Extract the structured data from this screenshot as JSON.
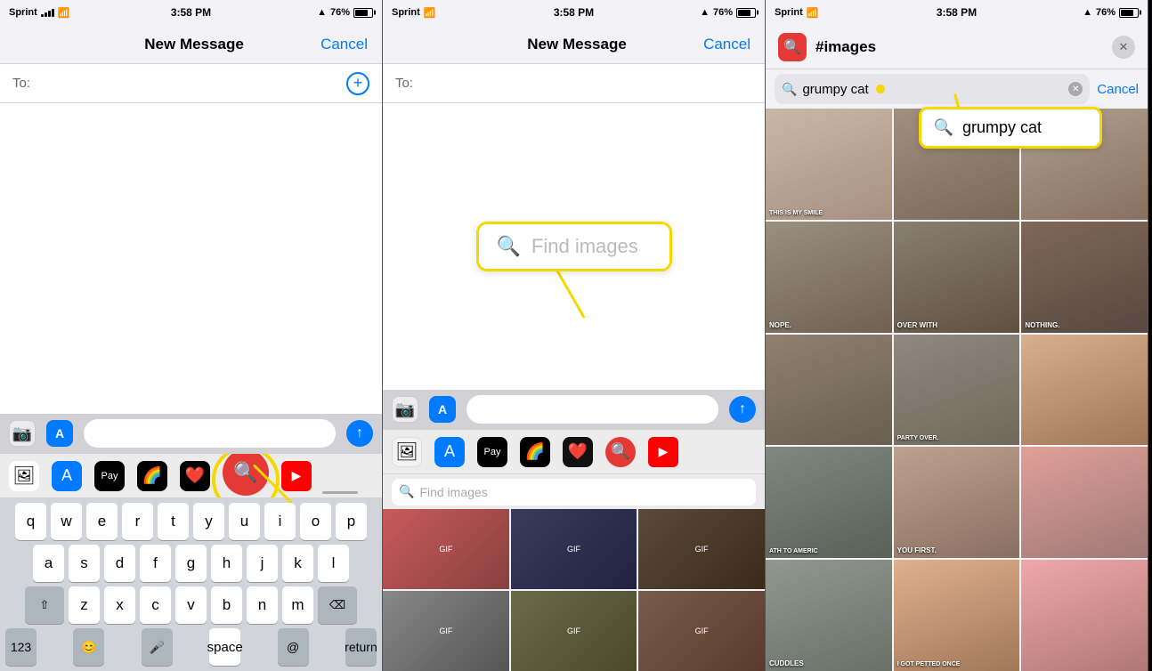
{
  "phone1": {
    "status": {
      "carrier": "Sprint",
      "time": "3:58 PM",
      "battery": "76%"
    },
    "nav": {
      "title": "New Message",
      "cancel": "Cancel"
    },
    "to_label": "To:",
    "app_tray": {
      "icons": [
        "📷",
        "🅰",
        "💳",
        "🌈",
        "❤",
        "🌐",
        "▶"
      ]
    },
    "keyboard": {
      "rows": [
        [
          "q",
          "w",
          "e",
          "r",
          "t",
          "y",
          "u",
          "i",
          "o",
          "p"
        ],
        [
          "a",
          "s",
          "d",
          "f",
          "g",
          "h",
          "j",
          "k",
          "l"
        ],
        [
          "z",
          "x",
          "c",
          "v",
          "b",
          "n",
          "m"
        ]
      ],
      "bottom": [
        "123",
        "😊",
        "🎤",
        "space",
        "@",
        "return"
      ]
    },
    "circle_label": "search images app icon",
    "tray_app_highlighted": "🌐"
  },
  "phone2": {
    "status": {
      "carrier": "Sprint",
      "time": "3:58 PM",
      "battery": "76%"
    },
    "nav": {
      "title": "New Message",
      "cancel": "Cancel"
    },
    "to_label": "To:",
    "find_images_placeholder": "Find images",
    "find_images_bottom": "Find images",
    "gif_cells": [
      {
        "color": "#c85a5a",
        "label": ""
      },
      {
        "color": "#3a3a5c",
        "label": ""
      },
      {
        "color": "#5a4a3a",
        "label": ""
      }
    ]
  },
  "phone3": {
    "status": {
      "carrier": "Sprint",
      "time": "3:58 PM",
      "battery": "76%"
    },
    "header": {
      "title": "#images",
      "close": "✕"
    },
    "search": {
      "query": "grumpy cat",
      "cancel": "Cancel"
    },
    "cat_cells": [
      {
        "color": "#a89070",
        "label": "THIS IS MY SMILE"
      },
      {
        "color": "#8a7060",
        "label": ""
      },
      {
        "color": "#907868",
        "label": ""
      },
      {
        "color": "#888070",
        "label": "NOPE."
      },
      {
        "color": "#7a6858",
        "label": "OVER WITH"
      },
      {
        "color": "#6a5848",
        "label": "NOTHING."
      },
      {
        "color": "#706050",
        "label": ""
      },
      {
        "color": "#787068",
        "label": "PARTY OVER."
      },
      {
        "color": "#c8a080",
        "label": ""
      },
      {
        "color": "#707870",
        "label": "ATH TO AMERIC"
      },
      {
        "color": "#908070",
        "label": "YOU FIRST."
      },
      {
        "color": "#c08080",
        "label": ""
      },
      {
        "color": "#808880",
        "label": "CUDDLES"
      },
      {
        "color": "#d09080",
        "label": "I GOT PETTED ONCE"
      }
    ],
    "search_annotation": {
      "text": "grumpy cat",
      "icon": "🔍"
    }
  }
}
